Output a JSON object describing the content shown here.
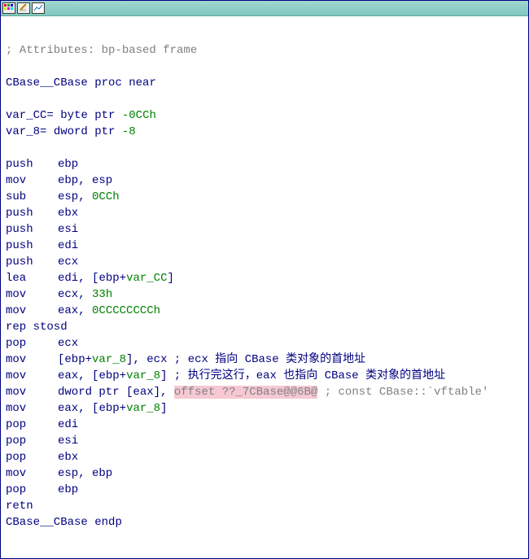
{
  "lines": {
    "attr": "; Attributes: bp-based frame",
    "procName": "CBase__CBase",
    "procKw": "proc near",
    "endp": "endp",
    "varCC": {
      "name": "var_CC",
      "eq": "=",
      "type": "byte ptr",
      "off": "-0CCh"
    },
    "var8": {
      "name": "var_8",
      "eq": "=",
      "type": "dword ptr",
      "off": "-8"
    }
  },
  "ins": {
    "0": {
      "m": "push",
      "a": "ebp"
    },
    "1": {
      "m": "mov",
      "a": "ebp, esp"
    },
    "2": {
      "m": "sub",
      "a": "esp",
      "b": "0CCh"
    },
    "3": {
      "m": "push",
      "a": "ebx"
    },
    "4": {
      "m": "push",
      "a": "esi"
    },
    "5": {
      "m": "push",
      "a": "edi"
    },
    "6": {
      "m": "push",
      "a": "ecx"
    },
    "7": {
      "m": "lea",
      "a": "edi",
      "c1": ", [",
      "r": "ebp",
      "plus": "+",
      "v": "var_CC",
      "c2": "]"
    },
    "8": {
      "m": "mov",
      "a": "ecx",
      "b": "33h"
    },
    "9": {
      "m": "mov",
      "a": "eax",
      "b": "0CCCCCCCCh"
    },
    "10": {
      "m": "rep stosd"
    },
    "11": {
      "m": "pop",
      "a": "ecx"
    },
    "12": {
      "m": "mov",
      "c1": "[",
      "r": "ebp",
      "plus": "+",
      "v": "var_8",
      "c2": "]",
      "b": "ecx",
      "cmt": "; ecx 指向 CBase 类对象的首地址"
    },
    "13": {
      "m": "mov",
      "a": "eax",
      "c1": ", [",
      "r": "ebp",
      "plus": "+",
      "v": "var_8",
      "c2": "]",
      "cmt": "; 执行完这行，eax 也指向 CBase 类对象的首地址"
    },
    "14": {
      "m": "mov",
      "a1": "dword ptr [",
      "r": "eax",
      "a2": "],",
      "off": "offset",
      "sym": "??_7CBase@@6B@",
      "cmt": "; const CBase::`vftable'"
    },
    "15": {
      "m": "mov",
      "a": "eax",
      "c1": ", [",
      "r": "ebp",
      "plus": "+",
      "v": "var_8",
      "c2": "]"
    },
    "16": {
      "m": "pop",
      "a": "edi"
    },
    "17": {
      "m": "pop",
      "a": "esi"
    },
    "18": {
      "m": "pop",
      "a": "ebx"
    },
    "19": {
      "m": "mov",
      "a": "esp, ebp"
    },
    "20": {
      "m": "pop",
      "a": "ebp"
    },
    "21": {
      "m": "retn"
    }
  }
}
